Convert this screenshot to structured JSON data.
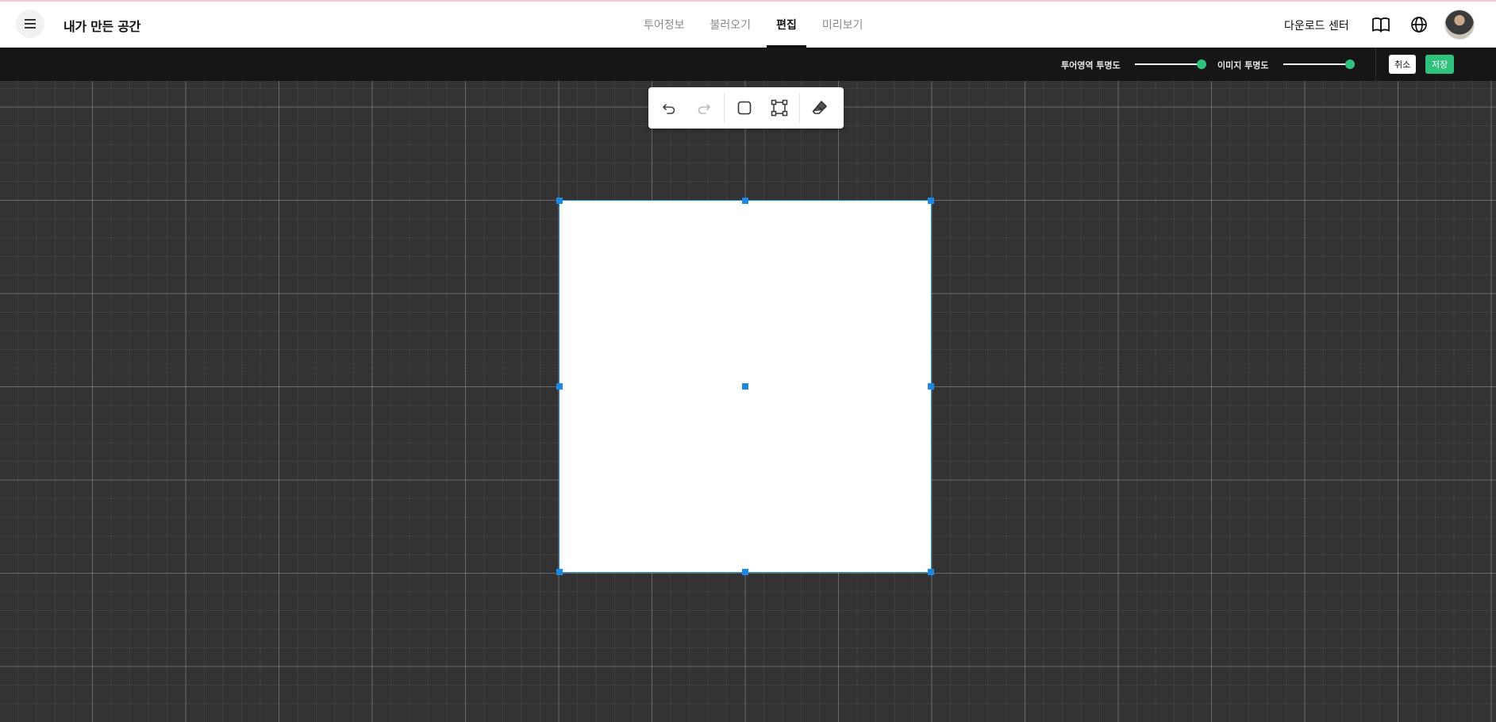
{
  "header": {
    "app_title": "내가 만든 공간",
    "tabs": [
      {
        "label": "투어정보",
        "active": false
      },
      {
        "label": "불러오기",
        "active": false
      },
      {
        "label": "편집",
        "active": true
      },
      {
        "label": "미리보기",
        "active": false
      }
    ],
    "download_label": "다운로드 센터",
    "icons": [
      "menu-icon",
      "book-icon",
      "globe-icon",
      "avatar"
    ]
  },
  "toolbar": {
    "tour_opacity_label": "투어영역 투명도",
    "tour_opacity_value": 1.0,
    "image_opacity_label": "이미지 투명도",
    "image_opacity_value": 1.0,
    "cancel_label": "취소",
    "save_label": "저장"
  },
  "palette": {
    "tools": [
      "undo-icon",
      "redo-icon",
      "rectangle-icon",
      "transform-icon",
      "eraser-icon"
    ]
  },
  "colors": {
    "accent_green": "#2ec27e",
    "selection_blue": "#1e88e5",
    "canvas_bg": "#333333",
    "strip_bg": "#161616"
  }
}
